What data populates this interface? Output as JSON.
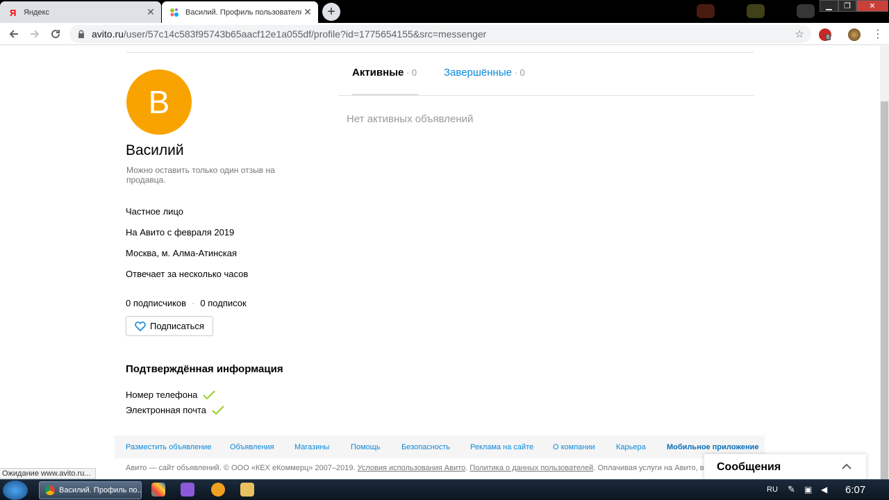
{
  "browser": {
    "tabs": [
      {
        "title": "Яндекс",
        "active": false,
        "favicon": "yandex-icon"
      },
      {
        "title": "Василий. Профиль пользователя на Авито",
        "active": true,
        "favicon": "avito-icon"
      }
    ],
    "url_host": "avito.ru",
    "url_path": "/user/57c14c583f95743b65aacf12e1a055df/profile?id=1775654155&src=messenger",
    "ext_badge": "6"
  },
  "profile": {
    "avatar_letter": "В",
    "avatar_color": "#f9a300",
    "name": "Василий",
    "note": "Можно оставить только один отзыв на продавца.",
    "type": "Частное лицо",
    "since": "На Авито с февраля 2019",
    "location": "Москва, м. Алма-Атинская",
    "response": "Отвечает за несколько часов",
    "subscribers": "0 подписчиков",
    "subscribers_sep": "·",
    "subscriptions": "0 подписок",
    "subscribe_label": "Подписаться"
  },
  "verified": {
    "title": "Подтверждённая информация",
    "items": [
      "Номер телефона",
      "Электронная почта"
    ]
  },
  "listings": {
    "tabs": [
      {
        "label": "Активные",
        "sep": " · ",
        "count": "0"
      },
      {
        "label": "Завершённые",
        "sep": " · ",
        "count": "0"
      }
    ],
    "empty": "Нет активных объявлений"
  },
  "footer": {
    "links": [
      "Разместить объявление",
      "Объявления",
      "Магазины",
      "Помощь",
      "Безопасность",
      "Реклама на сайте",
      "О компании",
      "Карьера",
      "Мобильное приложение"
    ],
    "legal_prefix": "Авито — сайт объявлений. © ООО «КЕХ еКоммерц» 2007–2019.",
    "legal_link1": "Условия использования Авито",
    "legal_link2": "Политика о данных пользователей",
    "legal_suffix": "Оплачивая услуги на Авито, вы принимаете"
  },
  "status_bar": "Ожидание www.avito.ru...",
  "chat": {
    "title": "Сообщения"
  },
  "taskbar": {
    "task_label": "Василий. Профиль по...",
    "lang": "RU",
    "clock": "6:07"
  }
}
